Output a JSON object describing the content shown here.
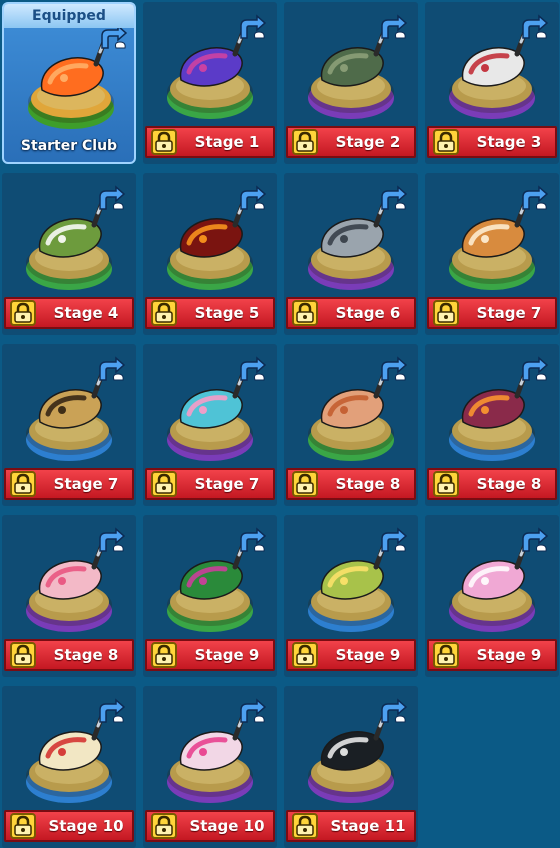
{
  "equipped_label": "Equipped",
  "clubs": [
    {
      "name": "Starter Club",
      "equipped": true,
      "pedestal": "#e0a63a",
      "ring": "#3e9e2a",
      "icon": "starter-club-icon",
      "head": "#ff6d1f",
      "accent": "#ffb36b"
    },
    {
      "name": "Stage 1",
      "locked": true,
      "pedestal": "#b89b4c",
      "ring": "#3aa646",
      "icon": "galaxy-club-icon",
      "head": "#5b3bc8",
      "accent": "#d5439f"
    },
    {
      "name": "Stage 2",
      "locked": true,
      "pedestal": "#b89b4c",
      "ring": "#7a3cb8",
      "icon": "camo-club-icon",
      "head": "#4f6b4a",
      "accent": "#8ea27a"
    },
    {
      "name": "Stage 3",
      "locked": true,
      "pedestal": "#b89b4c",
      "ring": "#7a3cb8",
      "icon": "playing-cards-club-icon",
      "head": "#e8e8e8",
      "accent": "#c0242f"
    },
    {
      "name": "Stage 4",
      "locked": true,
      "pedestal": "#b89b4c",
      "ring": "#3aa646",
      "icon": "daisy-club-icon",
      "head": "#6d9b3d",
      "accent": "#ffffff"
    },
    {
      "name": "Stage 5",
      "locked": true,
      "pedestal": "#b89b4c",
      "ring": "#3aa646",
      "icon": "flame-club-icon",
      "head": "#7a1410",
      "accent": "#ff9a1e"
    },
    {
      "name": "Stage 6",
      "locked": true,
      "pedestal": "#b89b4c",
      "ring": "#7a3cb8",
      "icon": "tiger-stripe-iron-icon",
      "head": "#9aa4ad",
      "accent": "#333b44"
    },
    {
      "name": "Stage 7",
      "locked": true,
      "pedestal": "#b89b4c",
      "ring": "#3aa646",
      "icon": "shiba-dog-club-icon",
      "head": "#d88b3e",
      "accent": "#fff1d8"
    },
    {
      "name": "Stage 7",
      "locked": true,
      "pedestal": "#b89b4c",
      "ring": "#2d7fd0",
      "icon": "leopard-club-icon",
      "head": "#caa256",
      "accent": "#2f2010"
    },
    {
      "name": "Stage 7",
      "locked": true,
      "pedestal": "#b89b4c",
      "ring": "#7a3cb8",
      "icon": "lotus-club-icon",
      "head": "#4fc3d6",
      "accent": "#ff9ac7"
    },
    {
      "name": "Stage 8",
      "locked": true,
      "pedestal": "#b89b4c",
      "ring": "#3aa646",
      "icon": "honeycomb-club-icon",
      "head": "#e2a07a",
      "accent": "#c25a2c"
    },
    {
      "name": "Stage 8",
      "locked": true,
      "pedestal": "#b89b4c",
      "ring": "#2d7fd0",
      "icon": "feather-club-icon",
      "head": "#8a2a4a",
      "accent": "#ff9a2e"
    },
    {
      "name": "Stage 8",
      "locked": true,
      "pedestal": "#b89b4c",
      "ring": "#7a3cb8",
      "icon": "flamingo-club-icon",
      "head": "#f3b9c7",
      "accent": "#e8507c"
    },
    {
      "name": "Stage 9",
      "locked": true,
      "pedestal": "#b89b4c",
      "ring": "#3aa646",
      "icon": "peacock-club-icon",
      "head": "#2a8a3a",
      "accent": "#d43aa0"
    },
    {
      "name": "Stage 9",
      "locked": true,
      "pedestal": "#b89b4c",
      "ring": "#2d7fd0",
      "icon": "avocado-club-icon",
      "head": "#a8c24a",
      "accent": "#ffe36b"
    },
    {
      "name": "Stage 9",
      "locked": true,
      "pedestal": "#b89b4c",
      "ring": "#7a3cb8",
      "icon": "cherry-blossom-club-icon",
      "head": "#f0a8d4",
      "accent": "#ffffff"
    },
    {
      "name": "Stage 10",
      "locked": true,
      "pedestal": "#b89b4c",
      "ring": "#2d7fd0",
      "icon": "popcorn-club-icon",
      "head": "#f2e7c4",
      "accent": "#d22a2a"
    },
    {
      "name": "Stage 10",
      "locked": true,
      "pedestal": "#b89b4c",
      "ring": "#7a3cb8",
      "icon": "masquerade-club-icon",
      "head": "#f2d7e6",
      "accent": "#e83a8a"
    },
    {
      "name": "Stage 11",
      "locked": true,
      "pedestal": "#b89b4c",
      "ring": "#7a3cb8",
      "icon": "panda-club-icon",
      "head": "#1a1f24",
      "accent": "#f2f2f2"
    }
  ]
}
